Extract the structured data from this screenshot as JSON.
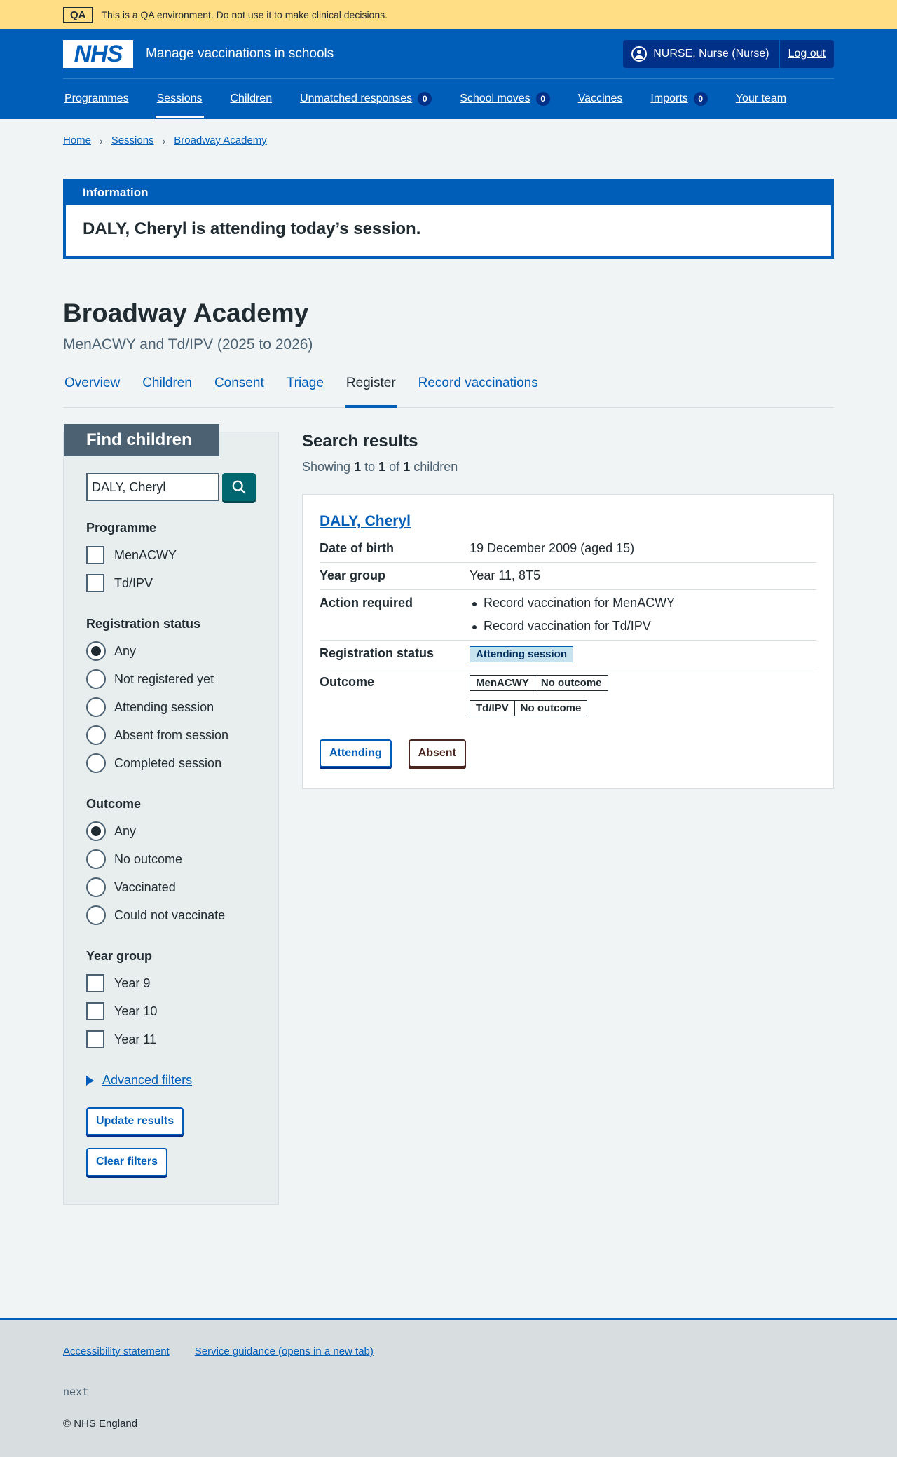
{
  "qa_banner": {
    "tag": "QA",
    "text": "This is a QA environment. Do not use it to make clinical decisions."
  },
  "header": {
    "logo": "NHS",
    "service_name": "Manage vaccinations in schools",
    "user": "NURSE, Nurse (Nurse)",
    "logout": "Log out"
  },
  "nav": [
    {
      "label": "Programmes"
    },
    {
      "label": "Sessions",
      "active": true
    },
    {
      "label": "Children"
    },
    {
      "label": "Unmatched responses",
      "count": "0"
    },
    {
      "label": "School moves",
      "count": "0"
    },
    {
      "label": "Vaccines"
    },
    {
      "label": "Imports",
      "count": "0"
    },
    {
      "label": "Your team"
    }
  ],
  "breadcrumb": [
    "Home",
    "Sessions",
    "Broadway Academy"
  ],
  "info": {
    "heading": "Information",
    "message": "DALY, Cheryl is attending today’s session."
  },
  "page": {
    "title": "Broadway Academy",
    "subtitle": "MenACWY and Td/IPV (2025 to 2026)"
  },
  "tabs": [
    "Overview",
    "Children",
    "Consent",
    "Triage",
    "Register",
    "Record vaccinations"
  ],
  "filters": {
    "title": "Find children",
    "search_value": "DALY, Cheryl",
    "programme": {
      "label": "Programme",
      "options": [
        "MenACWY",
        "Td/IPV"
      ]
    },
    "registration": {
      "label": "Registration status",
      "options": [
        "Any",
        "Not registered yet",
        "Attending session",
        "Absent from session",
        "Completed session"
      ],
      "selected": "Any"
    },
    "outcome": {
      "label": "Outcome",
      "options": [
        "Any",
        "No outcome",
        "Vaccinated",
        "Could not vaccinate"
      ],
      "selected": "Any"
    },
    "year_group": {
      "label": "Year group",
      "options": [
        "Year 9",
        "Year 10",
        "Year 11"
      ]
    },
    "advanced": "Advanced filters",
    "update": "Update results",
    "clear": "Clear filters"
  },
  "results": {
    "title": "Search results",
    "showing": "Showing",
    "from": "1",
    "to_word": "to",
    "to": "1",
    "of_word": "of",
    "total": "1",
    "unit": "children",
    "child": {
      "name": "DALY, Cheryl",
      "dob_label": "Date of birth",
      "dob": "19 December 2009 (aged 15)",
      "year_label": "Year group",
      "year": "Year 11, 8T5",
      "action_label": "Action required",
      "actions": [
        "Record vaccination for MenACWY",
        "Record vaccination for Td/IPV"
      ],
      "reg_label": "Registration status",
      "reg_status": "Attending session",
      "outcome_label": "Outcome",
      "outcomes": [
        {
          "programme": "MenACWY",
          "status": "No outcome"
        },
        {
          "programme": "Td/IPV",
          "status": "No outcome"
        }
      ],
      "attending_btn": "Attending",
      "absent_btn": "Absent"
    }
  },
  "footer": {
    "links": [
      "Accessibility statement",
      "Service guidance (opens in a new tab)"
    ],
    "version": "next",
    "copyright": "© NHS England"
  }
}
